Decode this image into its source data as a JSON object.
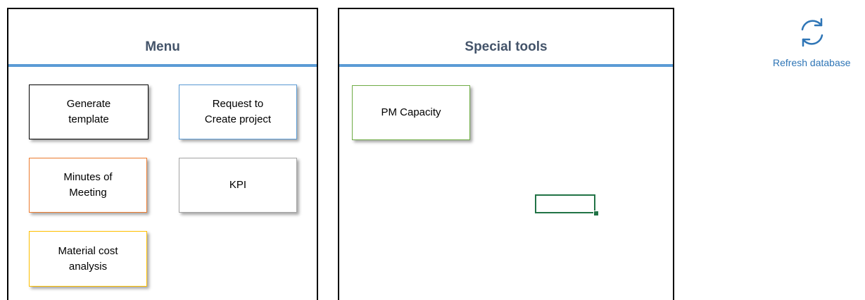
{
  "menu_panel": {
    "title": "Menu",
    "tiles": [
      {
        "label": "Generate\ntemplate",
        "border": "#000000"
      },
      {
        "label": "Request to\nCreate project",
        "border": "#5b9bd5"
      },
      {
        "label": "Minutes of\nMeeting",
        "border": "#ed7d31"
      },
      {
        "label": "KPI",
        "border": "#a5a5a5"
      },
      {
        "label": "Material cost\nanalysis",
        "border": "#ffc000"
      }
    ]
  },
  "tools_panel": {
    "title": "Special tools",
    "tiles": [
      {
        "label": "PM Capacity",
        "border": "#70ad47"
      }
    ]
  },
  "refresh": {
    "label": "Refresh database",
    "icon": "refresh-icon",
    "color": "#2e75b6"
  },
  "colors": {
    "title_text": "#44546a",
    "rule": "#5b9bd5",
    "selection": "#217346"
  }
}
